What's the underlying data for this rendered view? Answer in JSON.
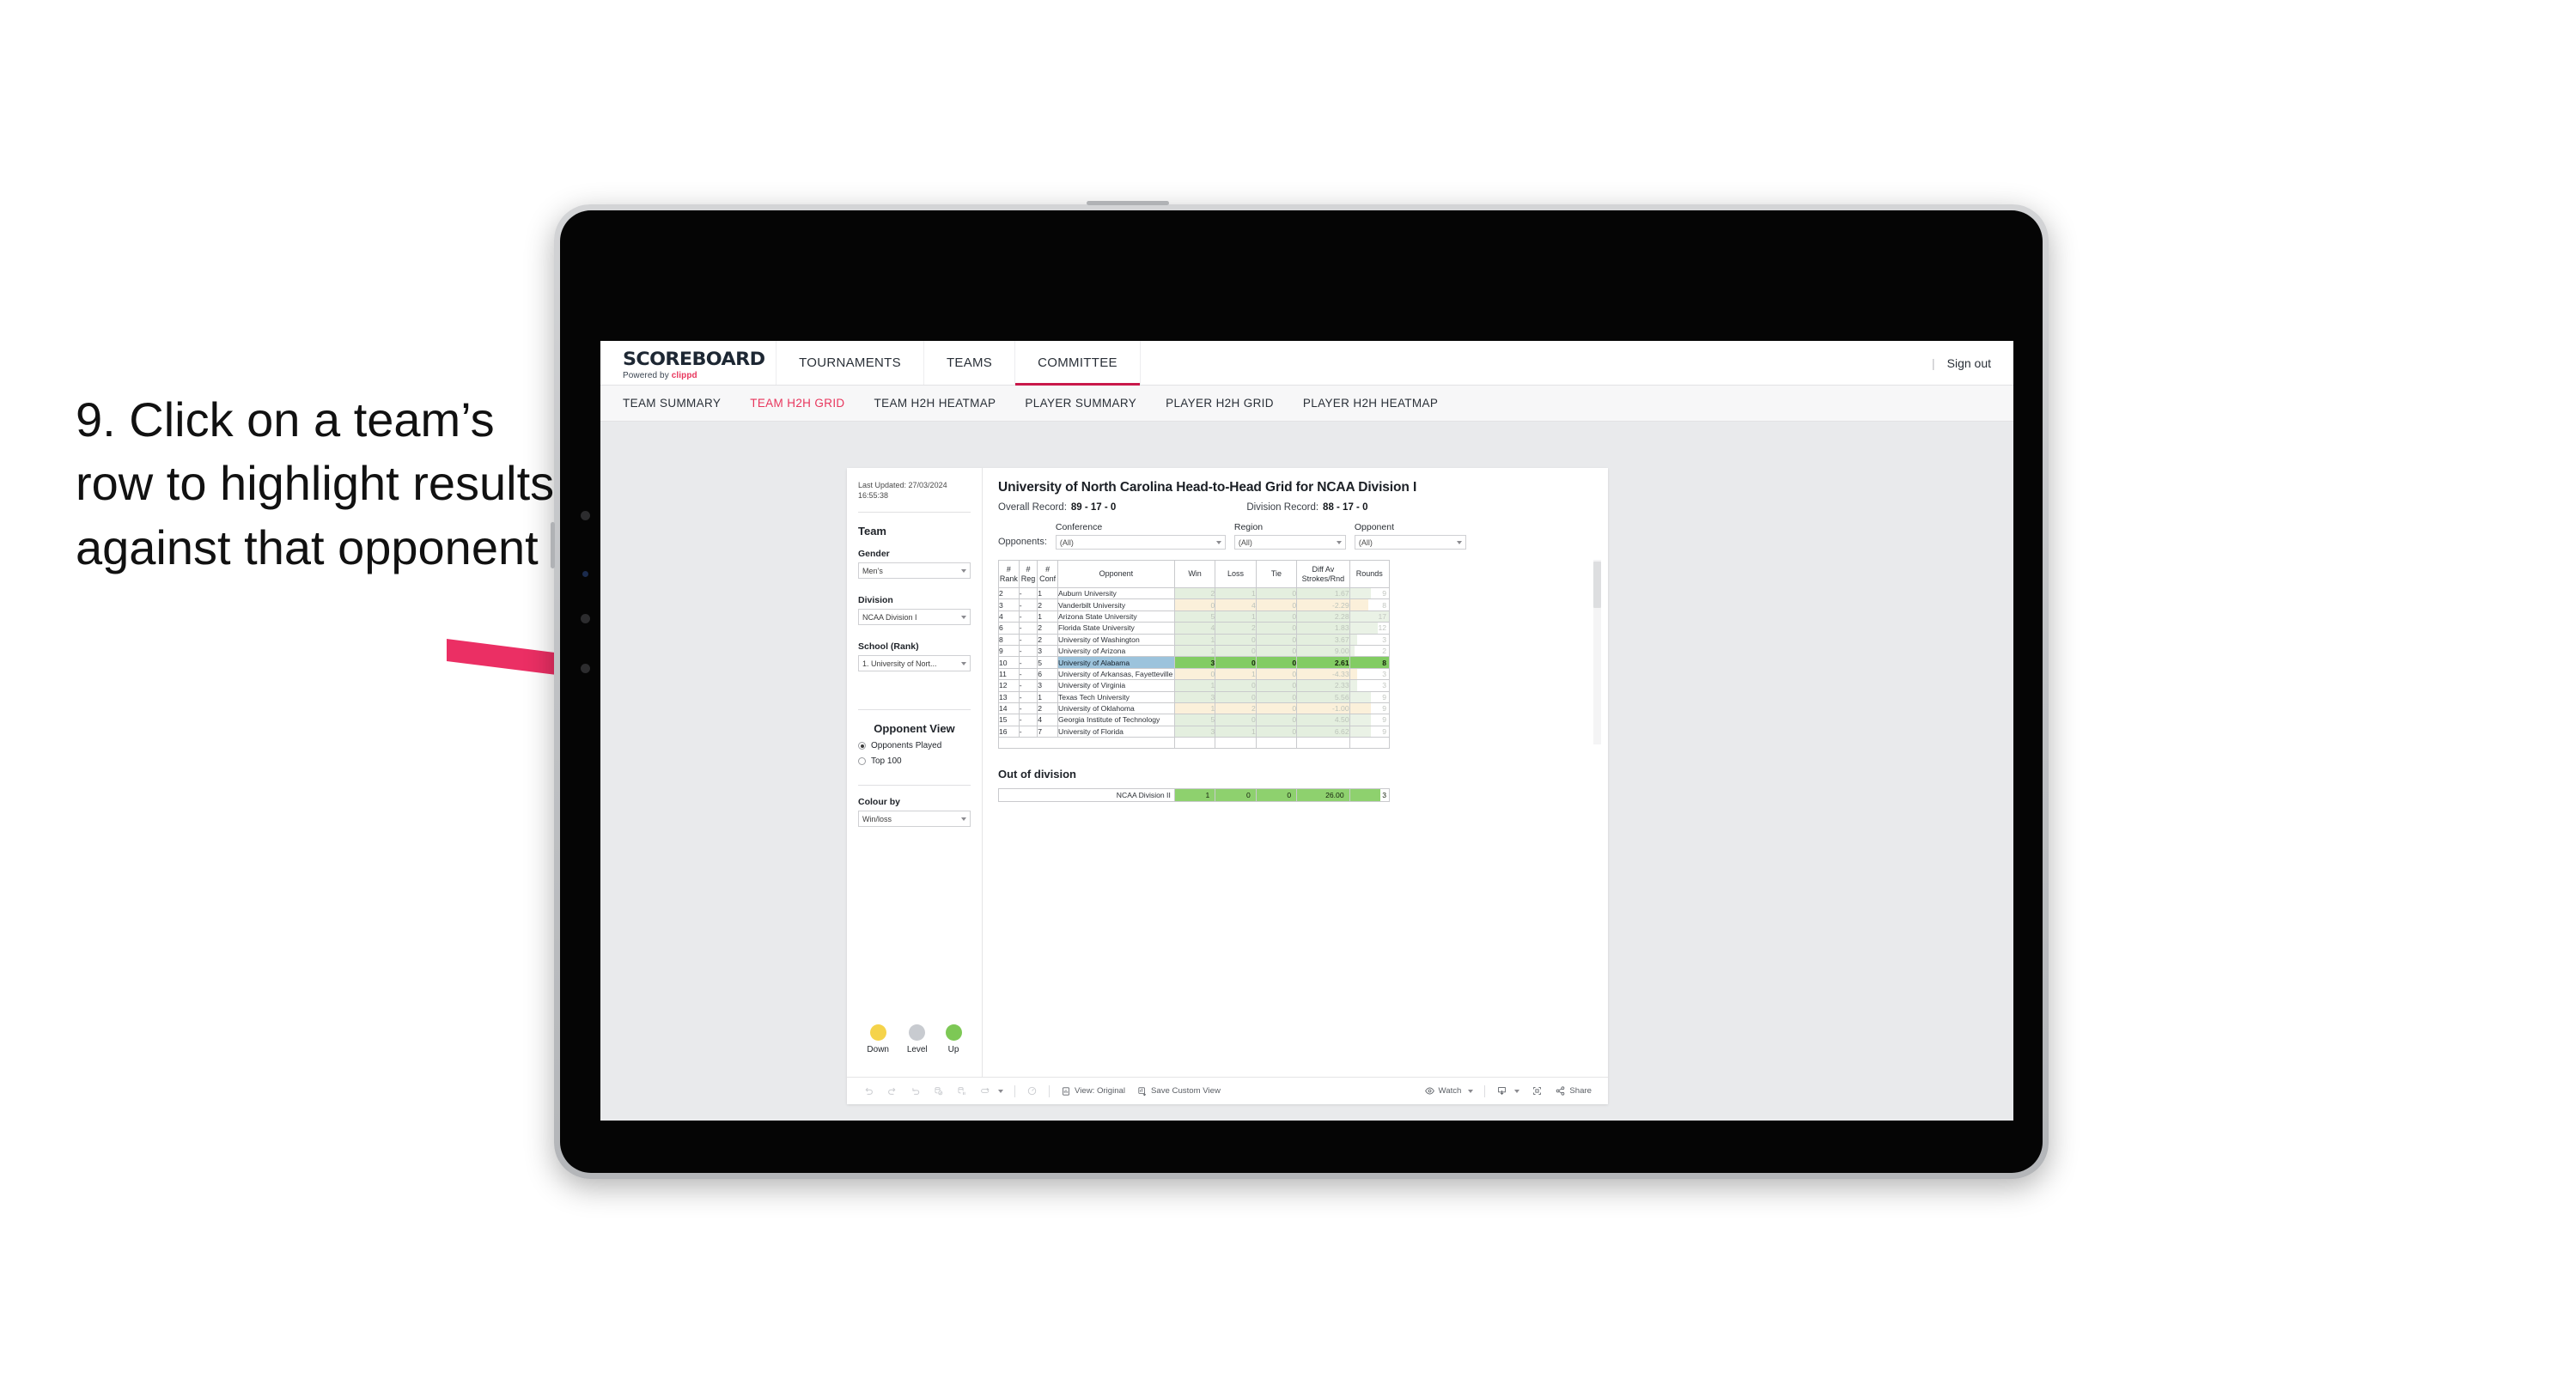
{
  "instruction": {
    "text": "9. Click on a team’s row to highlight results against that opponent"
  },
  "topnav": {
    "logo_word": "SCOREBOARD",
    "logo_powered": "Powered by ",
    "logo_brand": "clippd",
    "items": [
      {
        "label": "TOURNAMENTS",
        "active": false
      },
      {
        "label": "TEAMS",
        "active": false
      },
      {
        "label": "COMMITTEE",
        "active": true
      }
    ],
    "divider": "|",
    "signout": "Sign out"
  },
  "subnav": {
    "items": [
      {
        "label": "TEAM SUMMARY",
        "active": false
      },
      {
        "label": "TEAM H2H GRID",
        "active": true
      },
      {
        "label": "TEAM H2H HEATMAP",
        "active": false
      },
      {
        "label": "PLAYER SUMMARY",
        "active": false
      },
      {
        "label": "PLAYER H2H GRID",
        "active": false
      },
      {
        "label": "PLAYER H2H HEATMAP",
        "active": false
      }
    ]
  },
  "filters": {
    "last_updated": "Last Updated: 27/03/2024 16:55:38",
    "team_title": "Team",
    "gender_label": "Gender",
    "gender_value": "Men’s",
    "division_label": "Division",
    "division_value": "NCAA Division I",
    "school_label": "School (Rank)",
    "school_value": "1. University of Nort...",
    "opponent_view_title": "Opponent View",
    "radio_opponents_played": "Opponents Played",
    "radio_top_100": "Top 100",
    "colour_by_label": "Colour by",
    "colour_by_value": "Win/loss",
    "legend": [
      {
        "label": "Down",
        "color": "#f5d34a"
      },
      {
        "label": "Level",
        "color": "#c8cbd0"
      },
      {
        "label": "Up",
        "color": "#7dc855"
      }
    ]
  },
  "viz": {
    "title": "University of North Carolina Head-to-Head Grid for NCAA Division I",
    "overall_record_label": "Overall Record:",
    "overall_record_value": "89 - 17 - 0",
    "division_record_label": "Division Record:",
    "division_record_value": "88 - 17 - 0",
    "opponents_label": "Opponents:",
    "conference_label": "Conference",
    "conference_value": "(All)",
    "region_label": "Region",
    "region_value": "(All)",
    "opponent_label": "Opponent",
    "opponent_value": "(All)",
    "out_of_division_title": "Out of division"
  },
  "chart_data": {
    "type": "table",
    "title": "University of North Carolina Head-to-Head Grid for NCAA Division I",
    "columns": [
      "# Rank",
      "# Reg",
      "# Conf",
      "Opponent",
      "Win",
      "Loss",
      "Tie",
      "Diff Av Strokes/Rnd",
      "Rounds"
    ],
    "column_header_lines": [
      [
        "#",
        "Rank"
      ],
      [
        "#",
        "Reg"
      ],
      [
        "#",
        "Conf"
      ],
      [
        "Opponent"
      ],
      [
        "Win"
      ],
      [
        "Loss"
      ],
      [
        "Tie"
      ],
      [
        "Diff Av",
        "Strokes/Rnd"
      ],
      [
        "Rounds"
      ]
    ],
    "selected_row": "University of Alabama",
    "rows": [
      {
        "rank": "2",
        "reg": "-",
        "conf": "1",
        "opponent": "Auburn University",
        "win": "2",
        "loss": "1",
        "tie": "0",
        "diff": "1.67",
        "rounds": "9",
        "rounds_pct": 53,
        "tone": "up",
        "selected": false
      },
      {
        "rank": "3",
        "reg": "-",
        "conf": "2",
        "opponent": "Vanderbilt University",
        "win": "0",
        "loss": "4",
        "tie": "0",
        "diff": "-2.29",
        "rounds": "8",
        "rounds_pct": 47,
        "tone": "down",
        "selected": false
      },
      {
        "rank": "4",
        "reg": "-",
        "conf": "1",
        "opponent": "Arizona State University",
        "win": "5",
        "loss": "1",
        "tie": "0",
        "diff": "2.28",
        "rounds": "17",
        "rounds_pct": 100,
        "tone": "up",
        "selected": false
      },
      {
        "rank": "6",
        "reg": "-",
        "conf": "2",
        "opponent": "Florida State University",
        "win": "4",
        "loss": "2",
        "tie": "0",
        "diff": "1.83",
        "rounds": "12",
        "rounds_pct": 71,
        "tone": "up",
        "selected": false
      },
      {
        "rank": "8",
        "reg": "-",
        "conf": "2",
        "opponent": "University of Washington",
        "win": "1",
        "loss": "0",
        "tie": "0",
        "diff": "3.67",
        "rounds": "3",
        "rounds_pct": 18,
        "tone": "up",
        "selected": false
      },
      {
        "rank": "9",
        "reg": "-",
        "conf": "3",
        "opponent": "University of Arizona",
        "win": "1",
        "loss": "0",
        "tie": "0",
        "diff": "9.00",
        "rounds": "2",
        "rounds_pct": 12,
        "tone": "up",
        "selected": false
      },
      {
        "rank": "10",
        "reg": "-",
        "conf": "5",
        "opponent": "University of Alabama",
        "win": "3",
        "loss": "0",
        "tie": "0",
        "diff": "2.61",
        "rounds": "8",
        "rounds_pct": 47,
        "tone": "up",
        "selected": true
      },
      {
        "rank": "11",
        "reg": "-",
        "conf": "6",
        "opponent": "University of Arkansas, Fayetteville",
        "win": "0",
        "loss": "1",
        "tie": "0",
        "diff": "-4.33",
        "rounds": "3",
        "rounds_pct": 18,
        "tone": "down",
        "selected": false
      },
      {
        "rank": "12",
        "reg": "-",
        "conf": "3",
        "opponent": "University of Virginia",
        "win": "1",
        "loss": "0",
        "tie": "0",
        "diff": "2.33",
        "rounds": "3",
        "rounds_pct": 18,
        "tone": "up",
        "selected": false
      },
      {
        "rank": "13",
        "reg": "-",
        "conf": "1",
        "opponent": "Texas Tech University",
        "win": "3",
        "loss": "0",
        "tie": "0",
        "diff": "5.56",
        "rounds": "9",
        "rounds_pct": 53,
        "tone": "up",
        "selected": false
      },
      {
        "rank": "14",
        "reg": "-",
        "conf": "2",
        "opponent": "University of Oklahoma",
        "win": "1",
        "loss": "2",
        "tie": "0",
        "diff": "-1.00",
        "rounds": "9",
        "rounds_pct": 53,
        "tone": "down",
        "selected": false
      },
      {
        "rank": "15",
        "reg": "-",
        "conf": "4",
        "opponent": "Georgia Institute of Technology",
        "win": "5",
        "loss": "0",
        "tie": "0",
        "diff": "4.50",
        "rounds": "9",
        "rounds_pct": 53,
        "tone": "up",
        "selected": false
      },
      {
        "rank": "16",
        "reg": "-",
        "conf": "7",
        "opponent": "University of Florida",
        "win": "3",
        "loss": "1",
        "tie": "0",
        "diff": "6.62",
        "rounds": "9",
        "rounds_pct": 53,
        "tone": "up",
        "selected": false
      }
    ],
    "out_of_division": [
      {
        "label": "NCAA Division II",
        "win": "1",
        "loss": "0",
        "tie": "0",
        "diff": "26.00",
        "rounds": "3",
        "rounds_pct": 78
      }
    ]
  },
  "toolbar": {
    "undo": "undo-arrow",
    "redo": "redo-arrow",
    "revert": "revert-arrow",
    "refresh": "refresh-data",
    "pause": "pause-updates",
    "view_original": "View: Original",
    "save_custom_view": "Save Custom View",
    "watch": "Watch",
    "share": "Share"
  }
}
